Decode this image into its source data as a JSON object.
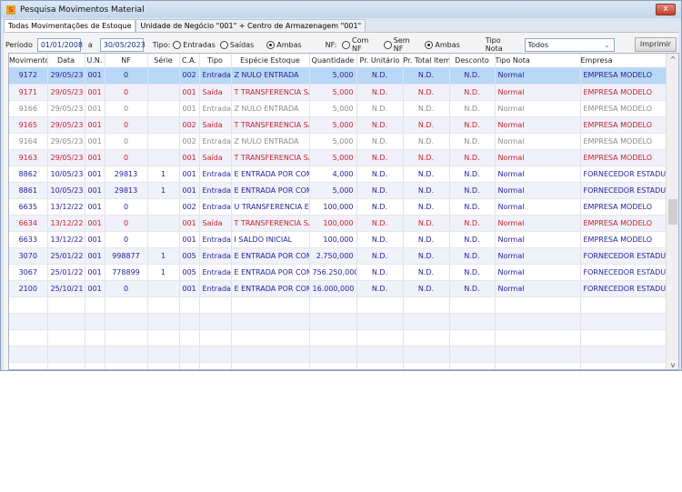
{
  "window": {
    "title": "Pesquisa Movimentos Material",
    "close": "x"
  },
  "tabs": [
    {
      "label": "Todas Movimentações de Estoque",
      "active": true
    },
    {
      "label": "Unidade de Negócio \"001\" + Centro de Armazenagem \"001\"",
      "active": false
    }
  ],
  "filters": {
    "periodo_label": "Período",
    "date_from": "01/01/2008",
    "a_label": "a",
    "date_to": "30/05/2023",
    "tipo_label": "Tipo:",
    "tipo_options": [
      "Entradas",
      "Saídas",
      "Ambas"
    ],
    "tipo_selected": "Ambas",
    "nf_label": "NF:",
    "nf_options": [
      "Com NF",
      "Sem NF",
      "Ambas"
    ],
    "nf_selected": "Ambas",
    "tipo_nota_label": "Tipo Nota",
    "tipo_nota_value": "Todos",
    "print_label": "Imprimir"
  },
  "colors": {
    "entrada": "#22229a",
    "saida": "#c8202e",
    "cancelled": "#8a8a8a",
    "selected": "#b8d8f5"
  },
  "columns": [
    "Movimento",
    "Data",
    "U.N.",
    "NF",
    "Série",
    "C.A.",
    "Tipo",
    "Espécie Estoque",
    "Quantidade",
    "Pr. Unitário",
    "Pr. Total Item",
    "Desconto",
    "Tipo Nota",
    "Empresa"
  ],
  "rows": [
    [
      "9172",
      "29/05/23",
      "001",
      "0",
      "",
      "002",
      "Entrada",
      "Z  NULO ENTRADA",
      "5,000",
      "N.D.",
      "N.D.",
      "N.D.",
      "Normal",
      "EMPRESA MODELO",
      "entrada"
    ],
    [
      "9171",
      "29/05/23",
      "001",
      "0",
      "",
      "001",
      "Saída",
      "T  TRANSFERENCIA SA",
      "5,000",
      "N.D.",
      "N.D.",
      "N.D.",
      "Normal",
      "EMPRESA MODELO",
      "saida"
    ],
    [
      "9166",
      "29/05/23",
      "001",
      "0",
      "",
      "001",
      "Entrada",
      "Z  NULO ENTRADA",
      "5,000",
      "N.D.",
      "N.D.",
      "N.D.",
      "Normal",
      "EMPRESA MODELO",
      "cancelled"
    ],
    [
      "9165",
      "29/05/23",
      "001",
      "0",
      "",
      "002",
      "Saída",
      "T  TRANSFERENCIA SA",
      "5,000",
      "N.D.",
      "N.D.",
      "N.D.",
      "Normal",
      "EMPRESA MODELO",
      "saida"
    ],
    [
      "9164",
      "29/05/23",
      "001",
      "0",
      "",
      "002",
      "Entrada",
      "Z  NULO ENTRADA",
      "5,000",
      "N.D.",
      "N.D.",
      "N.D.",
      "Normal",
      "EMPRESA MODELO",
      "cancelled"
    ],
    [
      "9163",
      "29/05/23",
      "001",
      "0",
      "",
      "001",
      "Saída",
      "T  TRANSFERENCIA SA",
      "5,000",
      "N.D.",
      "N.D.",
      "N.D.",
      "Normal",
      "EMPRESA MODELO",
      "saida"
    ],
    [
      "8862",
      "10/05/23",
      "001",
      "29813",
      "1",
      "001",
      "Entrada",
      "E  ENTRADA POR COMP",
      "4,000",
      "N.D.",
      "N.D.",
      "N.D.",
      "Normal",
      "FORNECEDOR ESTADUAL",
      "entrada"
    ],
    [
      "8861",
      "10/05/23",
      "001",
      "29813",
      "1",
      "001",
      "Entrada",
      "E  ENTRADA POR COMP",
      "5,000",
      "N.D.",
      "N.D.",
      "N.D.",
      "Normal",
      "FORNECEDOR ESTADUAL",
      "entrada"
    ],
    [
      "6635",
      "13/12/22",
      "001",
      "0",
      "",
      "002",
      "Entrada",
      "U  TRANSFERENCIA EN",
      "100,000",
      "N.D.",
      "N.D.",
      "N.D.",
      "Normal",
      "EMPRESA MODELO",
      "entrada"
    ],
    [
      "6634",
      "13/12/22",
      "001",
      "0",
      "",
      "001",
      "Saída",
      "T  TRANSFERENCIA SA",
      "100,000",
      "N.D.",
      "N.D.",
      "N.D.",
      "Normal",
      "EMPRESA MODELO",
      "saida"
    ],
    [
      "6633",
      "13/12/22",
      "001",
      "0",
      "",
      "001",
      "Entrada",
      "I  SALDO INICIAL",
      "100,000",
      "N.D.",
      "N.D.",
      "N.D.",
      "Normal",
      "EMPRESA MODELO",
      "entrada"
    ],
    [
      "3070",
      "25/01/22",
      "001",
      "998877",
      "1",
      "005",
      "Entrada",
      "E  ENTRADA POR COMP",
      "2.750,000",
      "N.D.",
      "N.D.",
      "N.D.",
      "Normal",
      "FORNECEDOR ESTADUAL",
      "entrada"
    ],
    [
      "3067",
      "25/01/22",
      "001",
      "778899",
      "1",
      "005",
      "Entrada",
      "E  ENTRADA POR COMP",
      "756.250,000",
      "N.D.",
      "N.D.",
      "N.D.",
      "Normal",
      "FORNECEDOR ESTADUAL",
      "entrada"
    ],
    [
      "2100",
      "25/10/21",
      "001",
      "0",
      "",
      "001",
      "Entrada",
      "E  ENTRADA POR COMP",
      "16.000,000",
      "N.D.",
      "N.D.",
      "N.D.",
      "Normal",
      "FORNECEDOR ESTADUAL",
      "entrada"
    ]
  ]
}
